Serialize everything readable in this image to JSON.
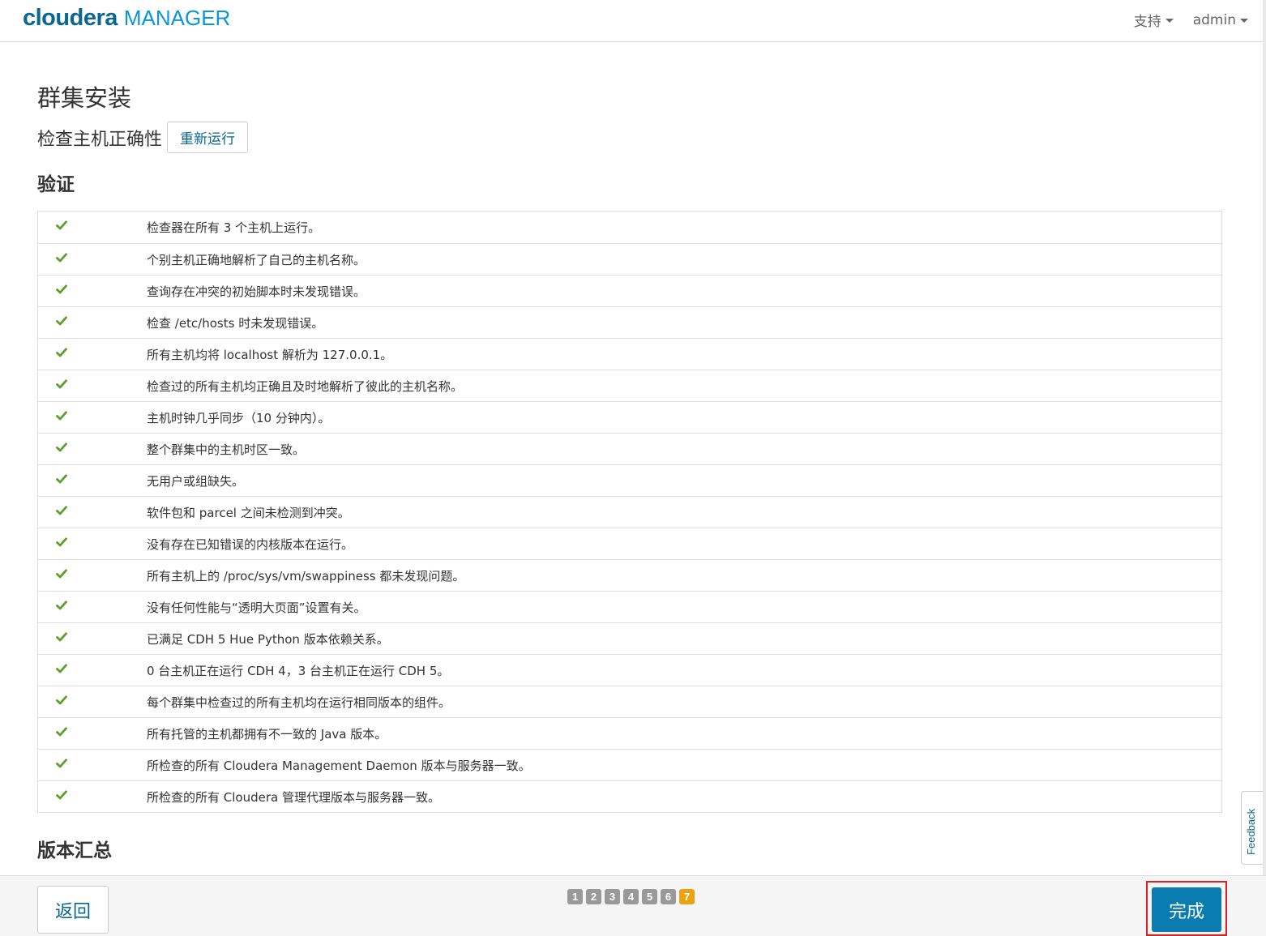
{
  "header": {
    "logo_main": "cloudera",
    "logo_sub": "MANAGER",
    "support_label": "支持",
    "user_label": "admin"
  },
  "page": {
    "title": "群集安装",
    "subtitle": "检查主机正确性",
    "rerun_label": "重新运行",
    "section_verify": "验证",
    "section_version": "版本汇总"
  },
  "checks": [
    "检查器在所有 3 个主机上运行。",
    "个别主机正确地解析了自己的主机名称。",
    "查询存在冲突的初始脚本时未发现错误。",
    "检查 /etc/hosts 时未发现错误。",
    "所有主机均将 localhost 解析为 127.0.0.1。",
    "检查过的所有主机均正确且及时地解析了彼此的主机名称。",
    "主机时钟几乎同步（10 分钟内）。",
    "整个群集中的主机时区一致。",
    "无用户或组缺失。",
    "软件包和 parcel 之间未检测到冲突。",
    "没有存在已知错误的内核版本在运行。",
    "所有主机上的 /proc/sys/vm/swappiness 都未发现问题。",
    "没有任何性能与“透明大页面”设置有关。",
    "已满足 CDH 5 Hue Python 版本依赖关系。",
    "0 台主机正在运行 CDH 4，3 台主机正在运行 CDH 5。",
    "每个群集中检查过的所有主机均在运行相同版本的组件。",
    "所有托管的主机都拥有不一致的 Java 版本。",
    "所检查的所有 Cloudera Management Daemon 版本与服务器一致。",
    "所检查的所有 Cloudera 管理代理版本与服务器一致。"
  ],
  "feedback_label": "Feedback",
  "footer": {
    "back_label": "返回",
    "finish_label": "完成",
    "steps": [
      "1",
      "2",
      "3",
      "4",
      "5",
      "6",
      "7"
    ],
    "active_step": "7"
  },
  "colors": {
    "brand": "#0a6890",
    "check_green": "#5aa02c",
    "active_step": "#e8a412",
    "primary_button": "#0a7cb0",
    "highlight_border": "#e02020"
  }
}
